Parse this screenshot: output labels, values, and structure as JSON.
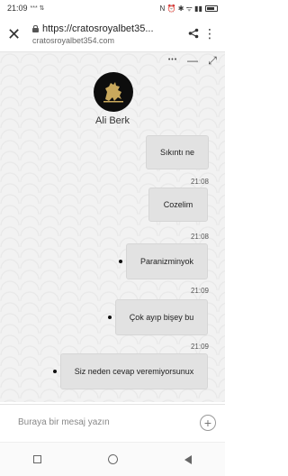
{
  "status_bar": {
    "time": "21:09",
    "signal_text": "*** ⇅",
    "icons_text": "N ⏰ ✱ ᯤ ▮▮"
  },
  "browser": {
    "url": "https://cratosroyalbet35...",
    "domain": "cratosroyalbet354.com",
    "close_glyph": "✕",
    "share_glyph": "⟨",
    "more_glyph": "⋮"
  },
  "chat": {
    "controls": {
      "more": "•••",
      "minimize": "—",
      "expand": "⤢"
    },
    "agent_name": "Ali Berk",
    "messages": [
      {
        "text": "Sıkıntı ne",
        "time": "21:08"
      },
      {
        "text": "Cozelim",
        "time": "21:08"
      },
      {
        "text": "Paranizminyok",
        "time": "21:09"
      },
      {
        "text": "Çok ayıp bişey bu",
        "time": "21:09"
      },
      {
        "text": "Siz neden cevap veremiyorsunux",
        "time": ""
      }
    ]
  },
  "composer": {
    "placeholder": "Buraya bir mesaj yazın",
    "plus_glyph": "+"
  },
  "colors": {
    "bubble": "#e2e2e2",
    "chat_bg": "#f2f2f2",
    "avatar_bg": "#0d0d0d",
    "lion_gold": "#c9a85c"
  }
}
